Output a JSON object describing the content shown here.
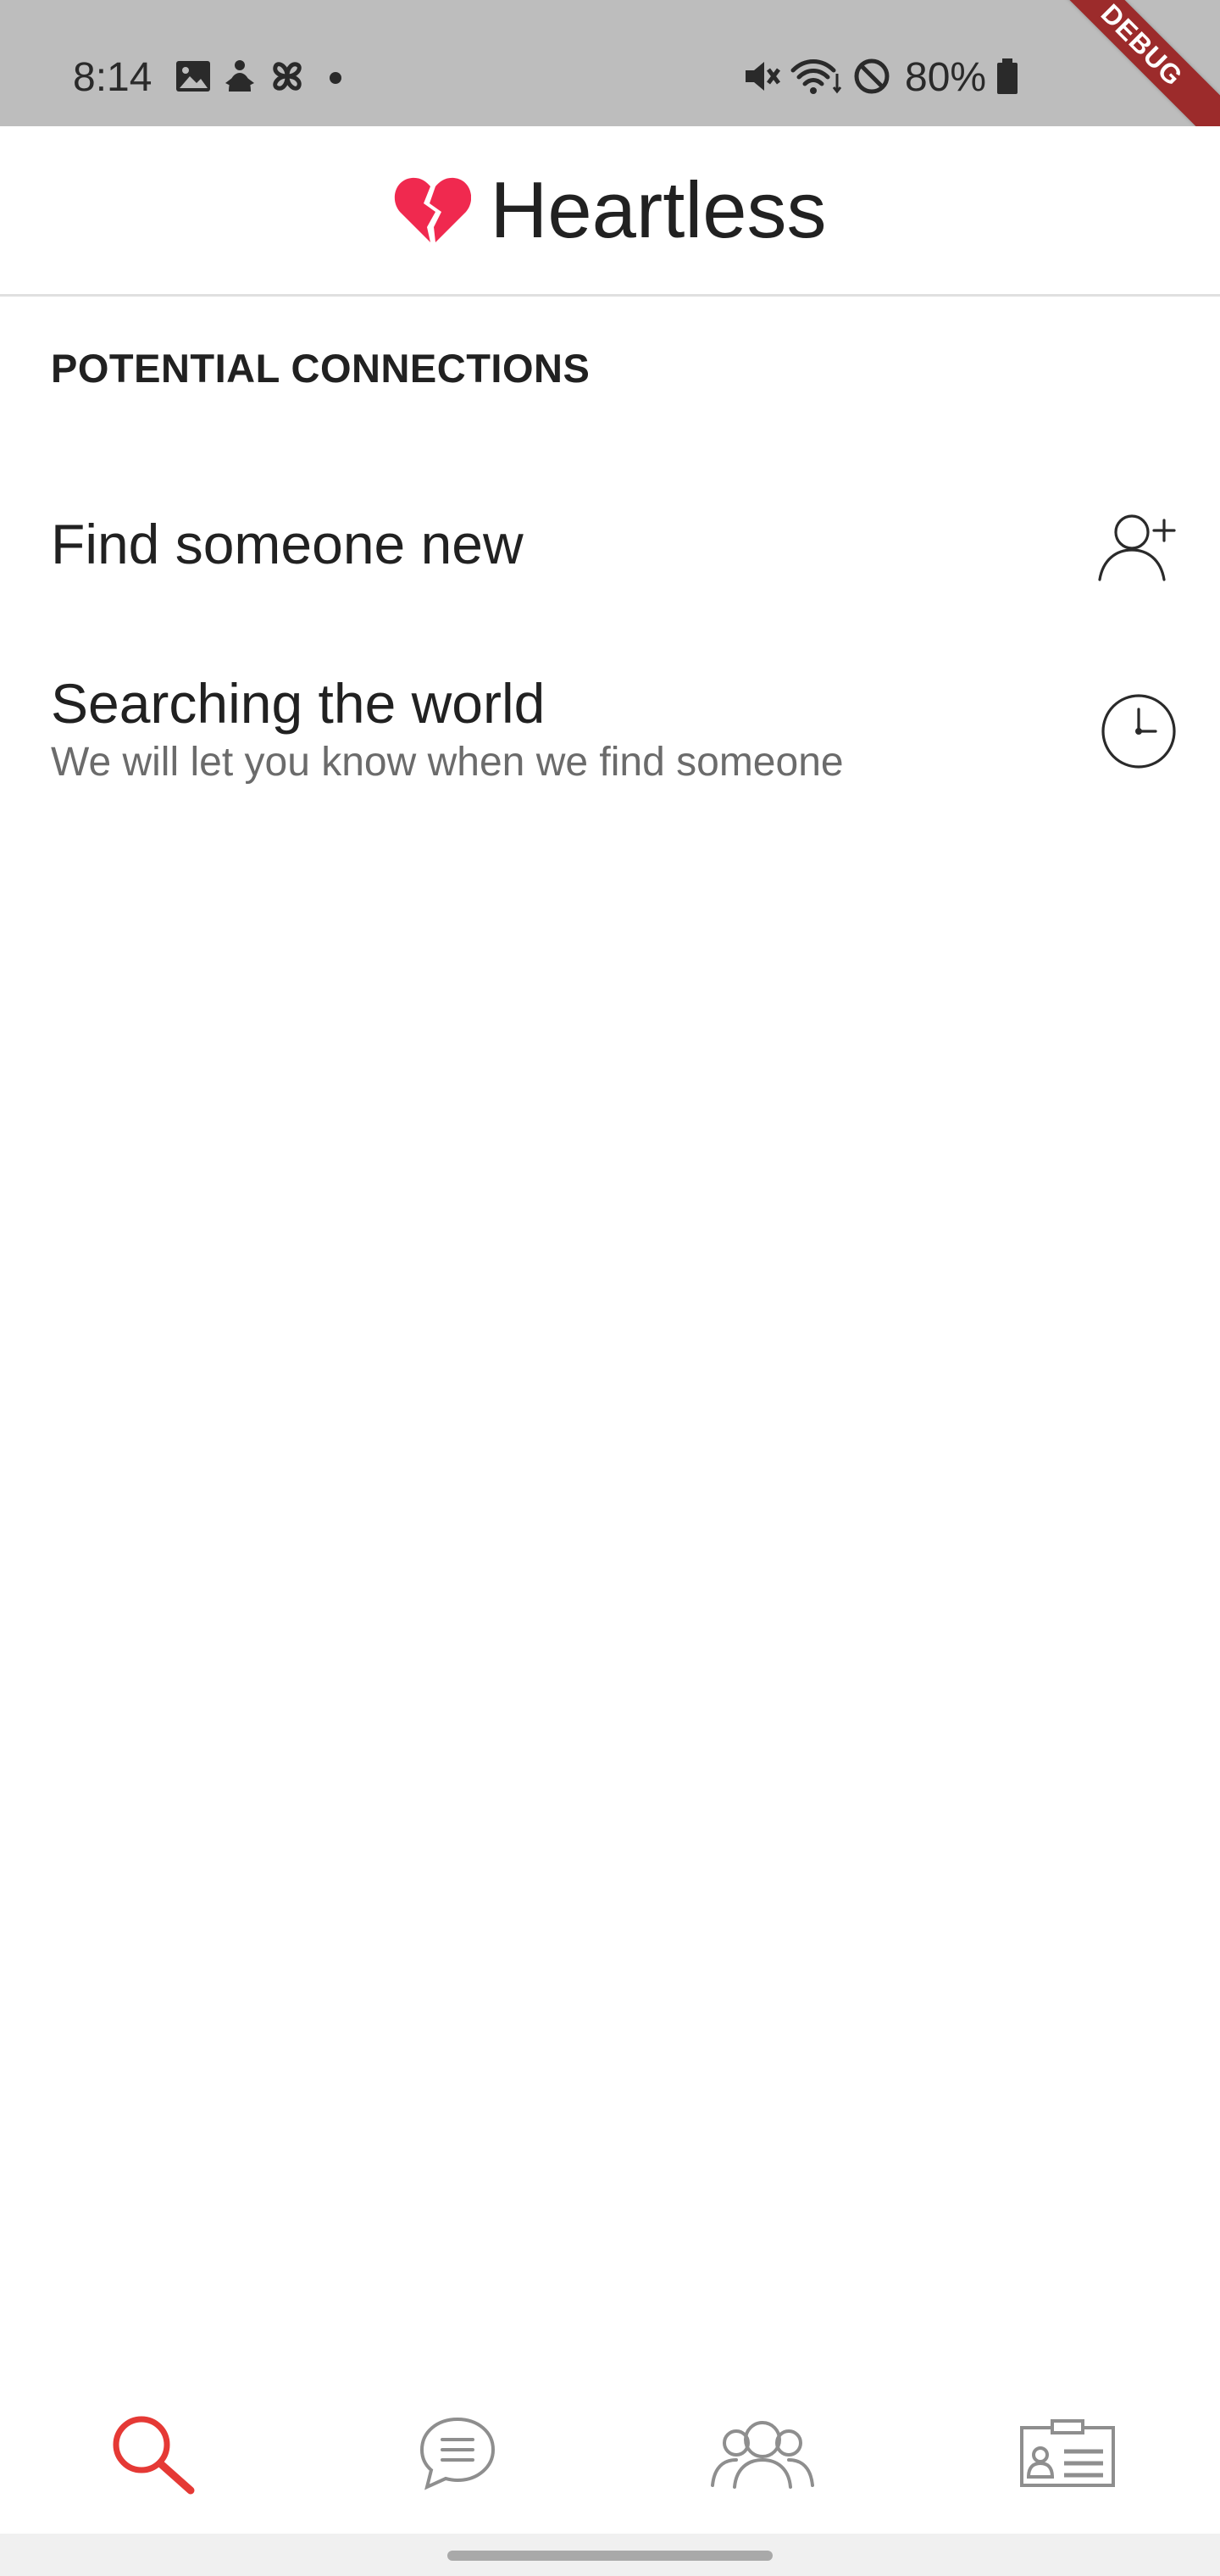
{
  "status_bar": {
    "time": "8:14",
    "battery_text": "80%",
    "left_icons": [
      "image-icon",
      "notification-icon",
      "pinwheel-icon",
      "dot-icon"
    ],
    "right_icons": [
      "vibrate-icon",
      "wifi-icon",
      "do-not-disturb-icon",
      "battery-icon"
    ]
  },
  "debug_banner": {
    "label": "DEBUG",
    "color": "#9c2b2b"
  },
  "app_bar": {
    "title": "Heartless",
    "logo_icon": "broken-heart-icon",
    "logo_color": "#f0294f"
  },
  "main": {
    "section_header": "POTENTIAL CONNECTIONS",
    "rows": [
      {
        "title": "Find someone new",
        "icon": "add-person-icon"
      },
      {
        "title": "Searching the world",
        "subtitle": "We will let you know when we find someone",
        "icon": "clock-icon"
      }
    ]
  },
  "bottom_nav": {
    "items": [
      {
        "name": "search",
        "icon": "search-icon",
        "active": true
      },
      {
        "name": "chat",
        "icon": "chat-icon",
        "active": false
      },
      {
        "name": "people",
        "icon": "people-icon",
        "active": false
      },
      {
        "name": "profile",
        "icon": "profile-card-icon",
        "active": false
      }
    ],
    "active_color": "#e53935",
    "inactive_color": "#8e8e8e"
  }
}
